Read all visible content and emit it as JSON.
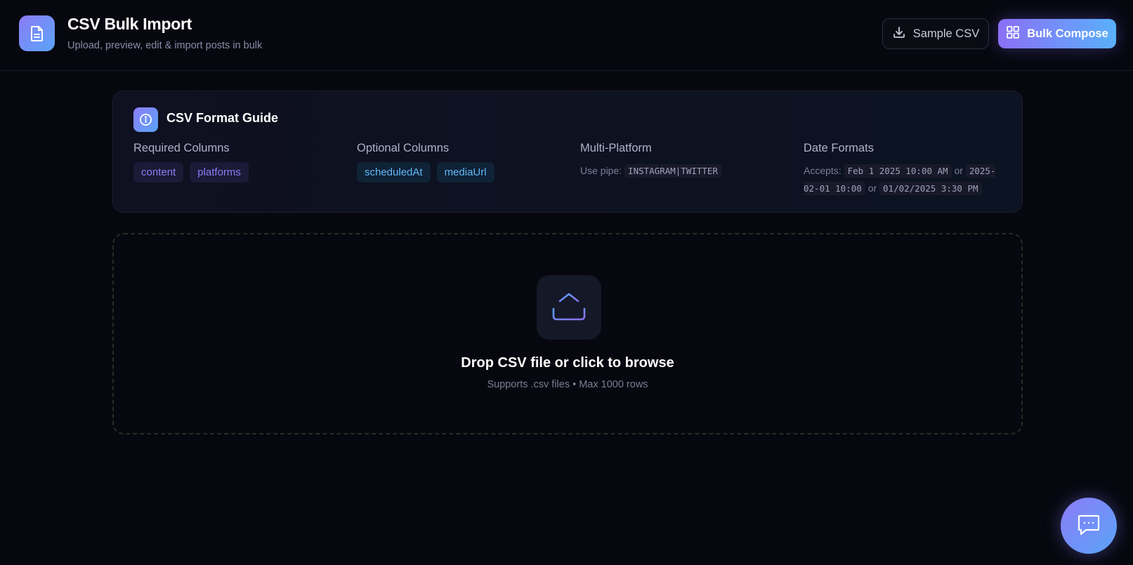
{
  "header": {
    "title": "CSV Bulk Import",
    "subtitle": "Upload, preview, edit & import posts in bulk",
    "app_icon": "document-icon",
    "sample_button": {
      "label": "Sample CSV",
      "icon": "download-icon"
    },
    "bulk_button": {
      "label": "Bulk Compose",
      "icon": "grid-icon"
    }
  },
  "guide": {
    "title": "CSV Format Guide",
    "icon": "info-icon",
    "required": {
      "heading": "Required Columns",
      "chips": [
        "content",
        "platforms"
      ]
    },
    "optional": {
      "heading": "Optional Columns",
      "chips": [
        "scheduledAt",
        "mediaUrl"
      ]
    },
    "multi_platform": {
      "heading": "Multi-Platform",
      "prefix": "Use pipe:",
      "example": "INSTAGRAM|TWITTER"
    },
    "date_formats": {
      "heading": "Date Formats",
      "prefix": "Accepts:",
      "formats": [
        "Feb 1 2025 10:00 AM",
        "2025-02-01 10:00",
        "01/02/2025 3:30 PM"
      ],
      "separator": "or"
    }
  },
  "dropzone": {
    "title": "Drop CSV file or click to browse",
    "subtitle": "Supports .csv files • Max 1000 rows",
    "icon": "upload-icon"
  },
  "chat_fab": {
    "icon": "chat-icon"
  },
  "colors": {
    "background": "#07070f",
    "accent_purple": "#8b6ff7",
    "accent_blue": "#5ab0fb"
  }
}
